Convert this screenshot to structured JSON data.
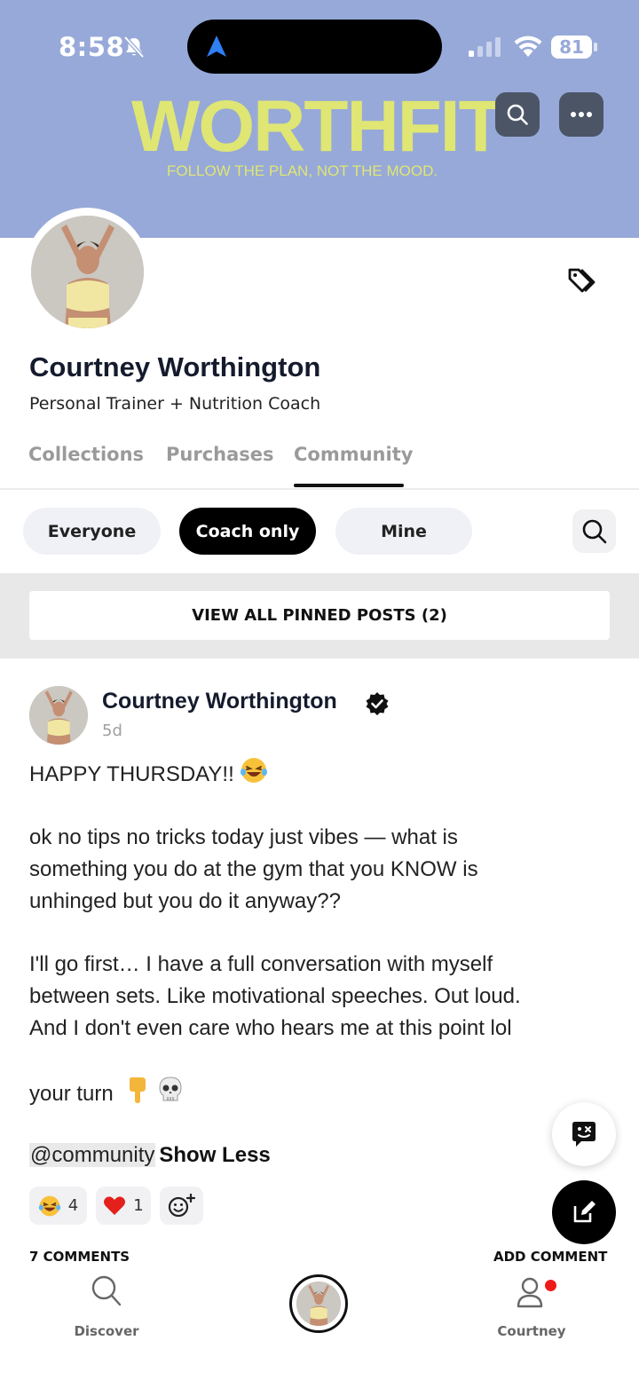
{
  "status_bar": {
    "time": "8:58",
    "battery": "81",
    "icons": [
      "bell-slash-icon",
      "location-arrow-icon",
      "signal-icon",
      "wifi-icon",
      "battery-icon"
    ]
  },
  "banner": {
    "brand": "WORTHFIT",
    "tagline": "FOLLOW THE PLAN, NOT THE MOOD.",
    "background_color": "#97a9d8",
    "brand_color": "#dfe673"
  },
  "profile": {
    "name": "Courtney Worthington",
    "subtitle": "Personal Trainer + Nutrition Coach"
  },
  "tabs": [
    {
      "label": "Collections",
      "active": false
    },
    {
      "label": "Purchases",
      "active": false
    },
    {
      "label": "Community",
      "active": true
    }
  ],
  "filters": [
    {
      "label": "Everyone",
      "active": false
    },
    {
      "label": "Coach only",
      "active": true
    },
    {
      "label": "Mine",
      "active": false
    }
  ],
  "pinned": {
    "label": "VIEW ALL PINNED POSTS (2)"
  },
  "post": {
    "author": "Courtney Worthington",
    "verified": true,
    "time": "5d",
    "lines": {
      "l1": "HAPPY THURSDAY!!",
      "l2": "ok no tips no tricks today just vibes — what is",
      "l3": "something you do at the gym that you KNOW is",
      "l4": "unhinged but you do it anyway??",
      "l5": "I'll go first… I have a full conversation with myself",
      "l6": "between sets. Like motivational speeches. Out loud.",
      "l7": "And I don't even care who hears me at this point lol",
      "l8": "your turn"
    },
    "mention": "@community",
    "show_less": "Show Less",
    "reactions": [
      {
        "icon": "laughing-tears-icon",
        "count": "4"
      },
      {
        "icon": "red-heart-icon",
        "count": "1"
      }
    ],
    "comments_label": "7 COMMENTS",
    "add_comment_label": "ADD COMMENT"
  },
  "bottom_nav": {
    "discover": "Discover",
    "profile": "Courtney"
  }
}
